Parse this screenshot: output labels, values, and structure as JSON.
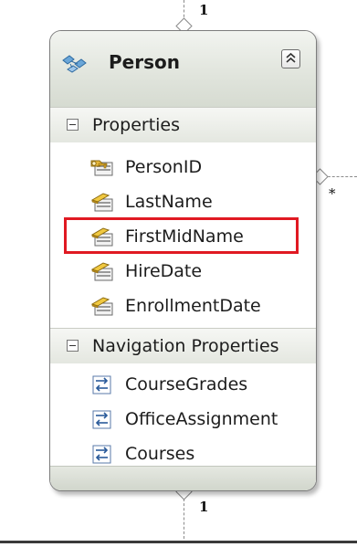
{
  "top_multiplicity": "1",
  "right_multiplicity": "*",
  "bottom_multiplicity": "1",
  "entity": {
    "title": "Person",
    "icon": "entity-icon",
    "collapse_icon": "double-chevron-up-icon"
  },
  "properties": {
    "label": "Properties",
    "items": [
      {
        "label": "PersonID",
        "icon": "key-property-icon"
      },
      {
        "label": "LastName",
        "icon": "property-icon"
      },
      {
        "label": "FirstMidName",
        "icon": "property-icon"
      },
      {
        "label": "HireDate",
        "icon": "property-icon"
      },
      {
        "label": "EnrollmentDate",
        "icon": "property-icon"
      }
    ]
  },
  "navigation": {
    "label": "Navigation Properties",
    "items": [
      {
        "label": "CourseGrades",
        "icon": "navigation-property-icon"
      },
      {
        "label": "OfficeAssignment",
        "icon": "navigation-property-icon"
      },
      {
        "label": "Courses",
        "icon": "navigation-property-icon"
      }
    ]
  },
  "highlight_color": "#e01922"
}
